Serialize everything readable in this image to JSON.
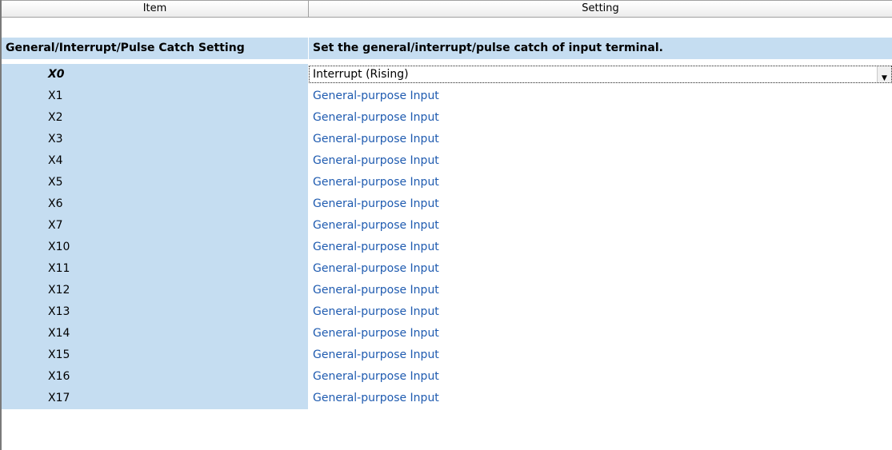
{
  "header": {
    "item": "Item",
    "setting": "Setting"
  },
  "category": {
    "label": "General/Interrupt/Pulse Catch Setting",
    "description": "Set the general/interrupt/pulse catch of input terminal."
  },
  "rows": [
    {
      "name": "X0",
      "value": "Interrupt (Rising)"
    },
    {
      "name": "X1",
      "value": "General-purpose Input"
    },
    {
      "name": "X2",
      "value": "General-purpose Input"
    },
    {
      "name": "X3",
      "value": "General-purpose Input"
    },
    {
      "name": "X4",
      "value": "General-purpose Input"
    },
    {
      "name": "X5",
      "value": "General-purpose Input"
    },
    {
      "name": "X6",
      "value": "General-purpose Input"
    },
    {
      "name": "X7",
      "value": "General-purpose Input"
    },
    {
      "name": "X10",
      "value": "General-purpose Input"
    },
    {
      "name": "X11",
      "value": "General-purpose Input"
    },
    {
      "name": "X12",
      "value": "General-purpose Input"
    },
    {
      "name": "X13",
      "value": "General-purpose Input"
    },
    {
      "name": "X14",
      "value": "General-purpose Input"
    },
    {
      "name": "X15",
      "value": "General-purpose Input"
    },
    {
      "name": "X16",
      "value": "General-purpose Input"
    },
    {
      "name": "X17",
      "value": "General-purpose Input"
    }
  ],
  "icons": {
    "dropdown": "chevron-down-icon"
  },
  "colors": {
    "left_column_bg": "#c5ddf1",
    "value_text": "#1f5bb0"
  }
}
